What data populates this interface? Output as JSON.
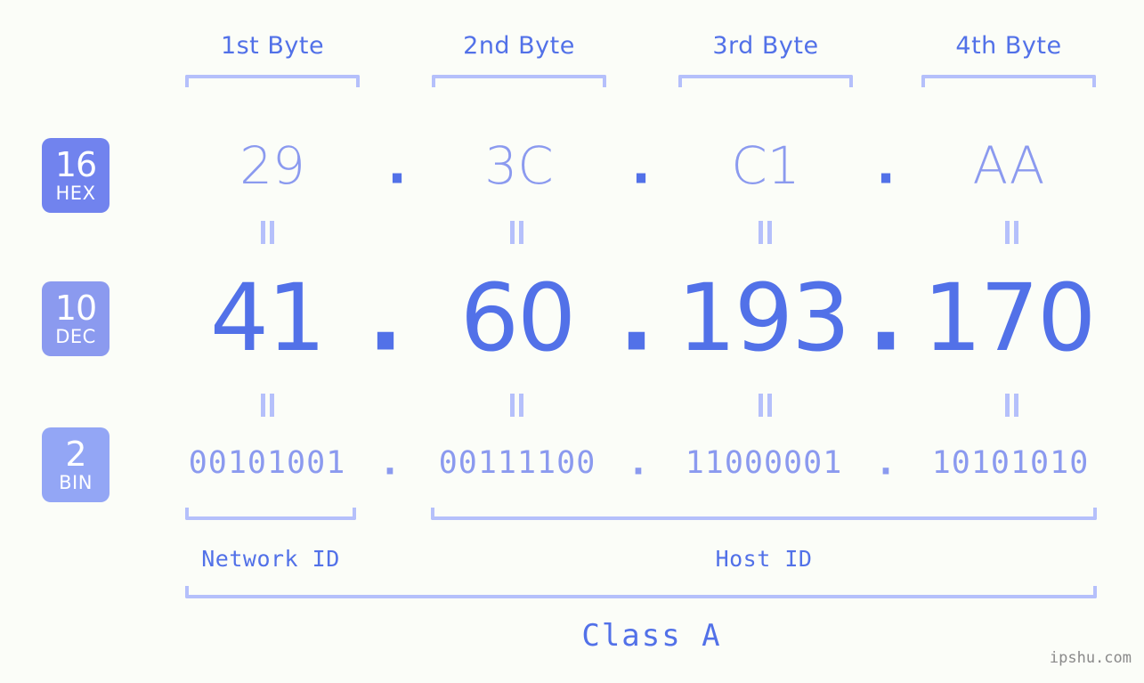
{
  "meta": {
    "background_color": "#fbfdf8",
    "accent_dark": "#5271e8",
    "accent_mid": "#8b9aef",
    "accent_light": "#b5c0fb"
  },
  "byte_headers": [
    {
      "label": "1st Byte"
    },
    {
      "label": "2nd Byte"
    },
    {
      "label": "3rd Byte"
    },
    {
      "label": "4th Byte"
    }
  ],
  "bases": [
    {
      "number": "16",
      "name": "HEX",
      "color": "#7183ee"
    },
    {
      "number": "10",
      "name": "DEC",
      "color": "#8b9aef"
    },
    {
      "number": "2",
      "name": "BIN",
      "color": "#93a6f5"
    }
  ],
  "rows": {
    "hex": {
      "values": [
        "29",
        "3C",
        "C1",
        "AA"
      ],
      "separator": "."
    },
    "dec": {
      "values": [
        "41",
        "60",
        "193",
        "170"
      ],
      "separator": "."
    },
    "bin": {
      "values": [
        "00101001",
        "00111100",
        "11000001",
        "10101010"
      ],
      "separator": "."
    }
  },
  "equals_separator": "=",
  "sections": [
    {
      "label": "Network ID"
    },
    {
      "label": "Host ID"
    }
  ],
  "class": {
    "label": "Class A"
  },
  "watermark": {
    "text": "ipshu.com"
  }
}
